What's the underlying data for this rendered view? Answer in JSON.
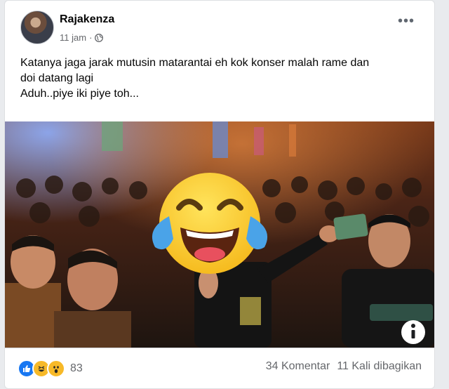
{
  "post": {
    "author": "Rajakenza",
    "time": "11 jam",
    "privacy_icon": "globe-icon",
    "more_icon": "more-options-icon",
    "text_lines": [
      "Katanya jaga jarak mutusin matarantai eh kok konser malah rame dan",
      "doi datang lagi",
      "Aduh..piye iki piye toh..."
    ]
  },
  "photo": {
    "overlay_emoji": "tears-of-joy-emoji",
    "info_icon": "info-icon"
  },
  "footer": {
    "reaction_icons": [
      "like-icon",
      "haha-icon",
      "wow-icon"
    ],
    "reaction_count": "83",
    "comments": "34 Komentar",
    "shares": "11 Kali dibagikan"
  },
  "colors": {
    "like_blue": "#1877f2",
    "reaction_yellow": "#f7b928",
    "text_secondary": "#65676b"
  }
}
